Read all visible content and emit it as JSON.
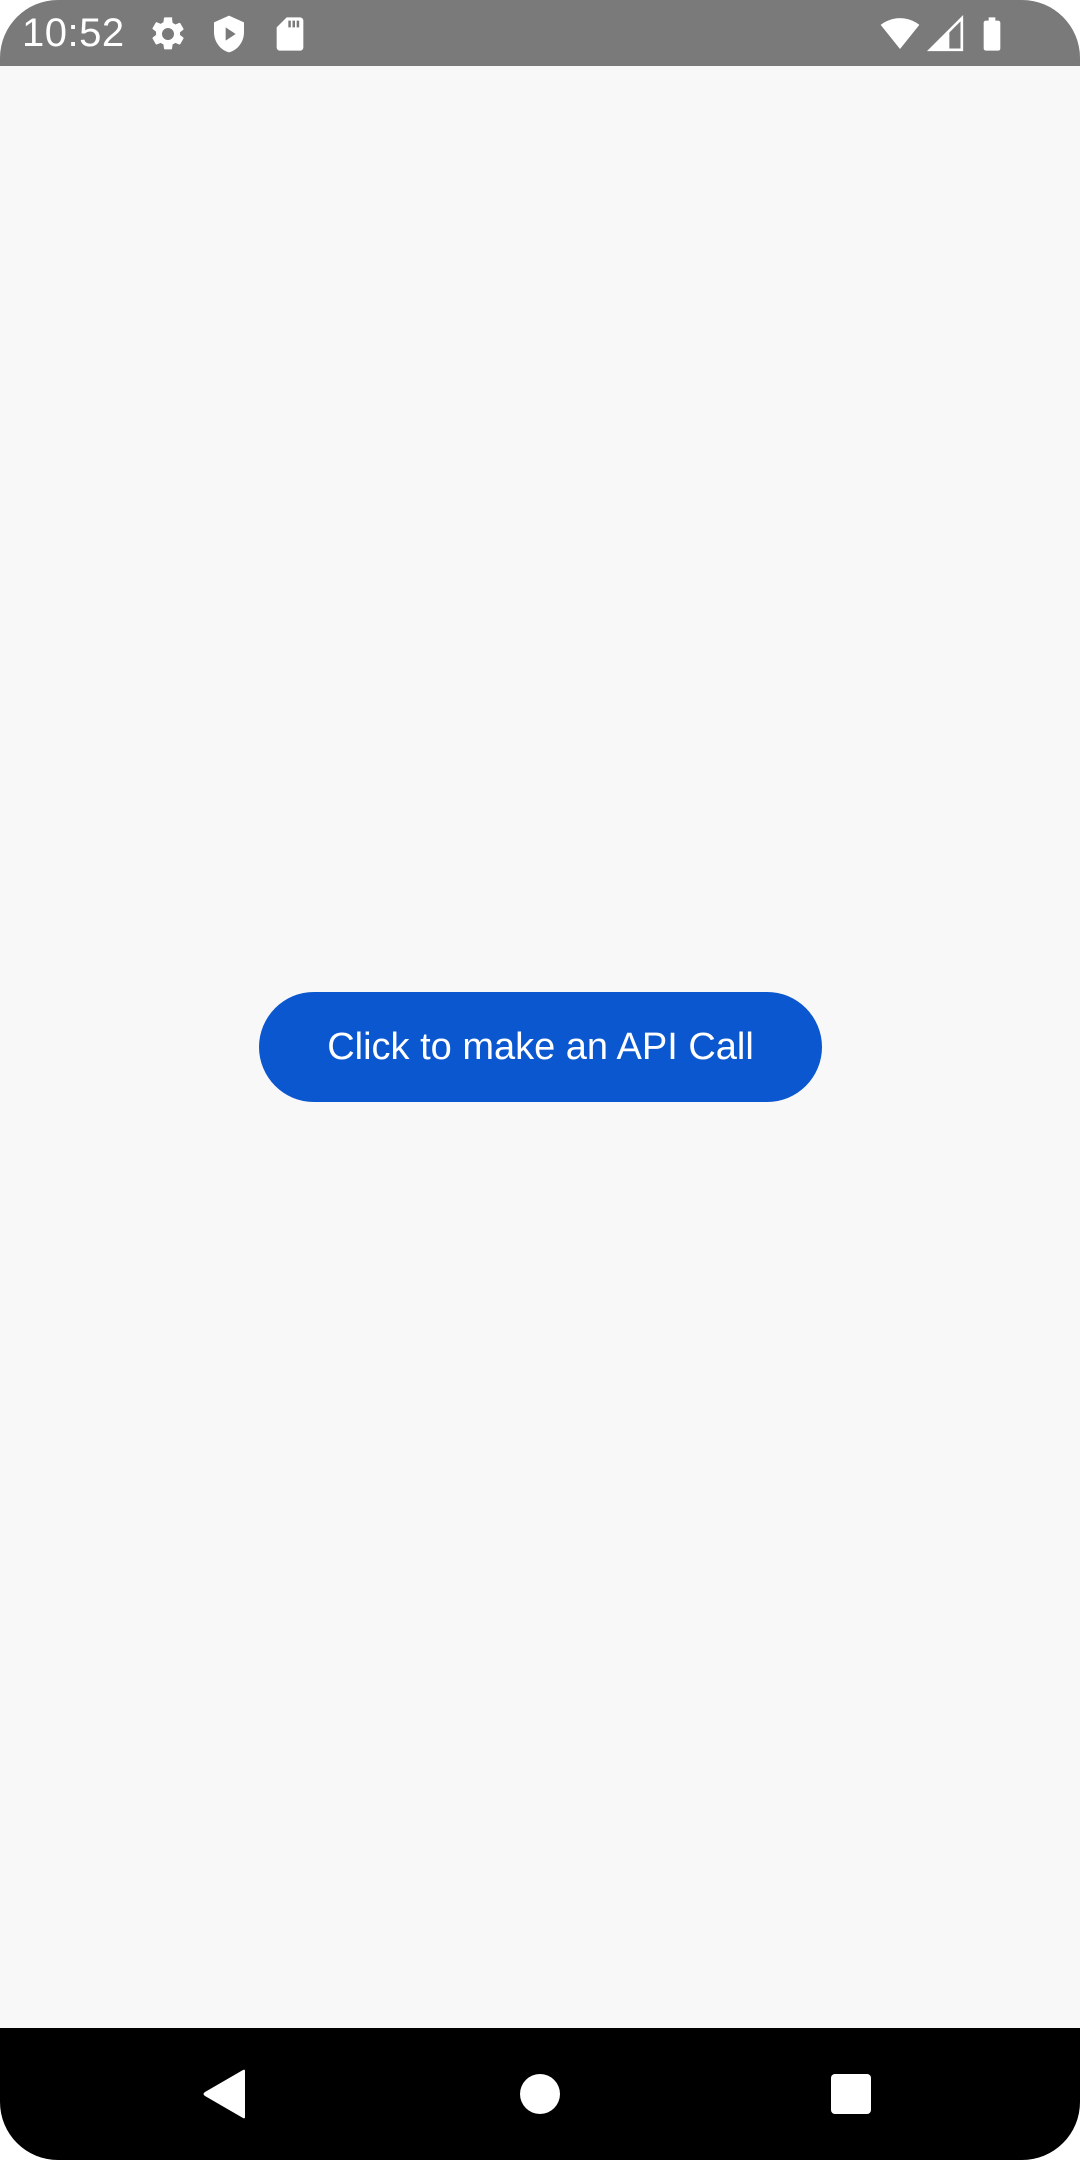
{
  "status_bar": {
    "time": "10:52",
    "left_icons": [
      "gear-icon",
      "play-protect-icon",
      "sd-card-icon"
    ],
    "right_icons": [
      "wifi-icon",
      "cell-signal-icon",
      "battery-icon"
    ],
    "background": "#7a7a7a"
  },
  "main": {
    "api_button_label": "Click to make an API Call",
    "api_button_color": "#0b57d0",
    "background": "#f8f8f8"
  },
  "nav_bar": {
    "buttons": [
      "back-icon",
      "home-icon",
      "recents-icon"
    ],
    "background": "#000000"
  }
}
